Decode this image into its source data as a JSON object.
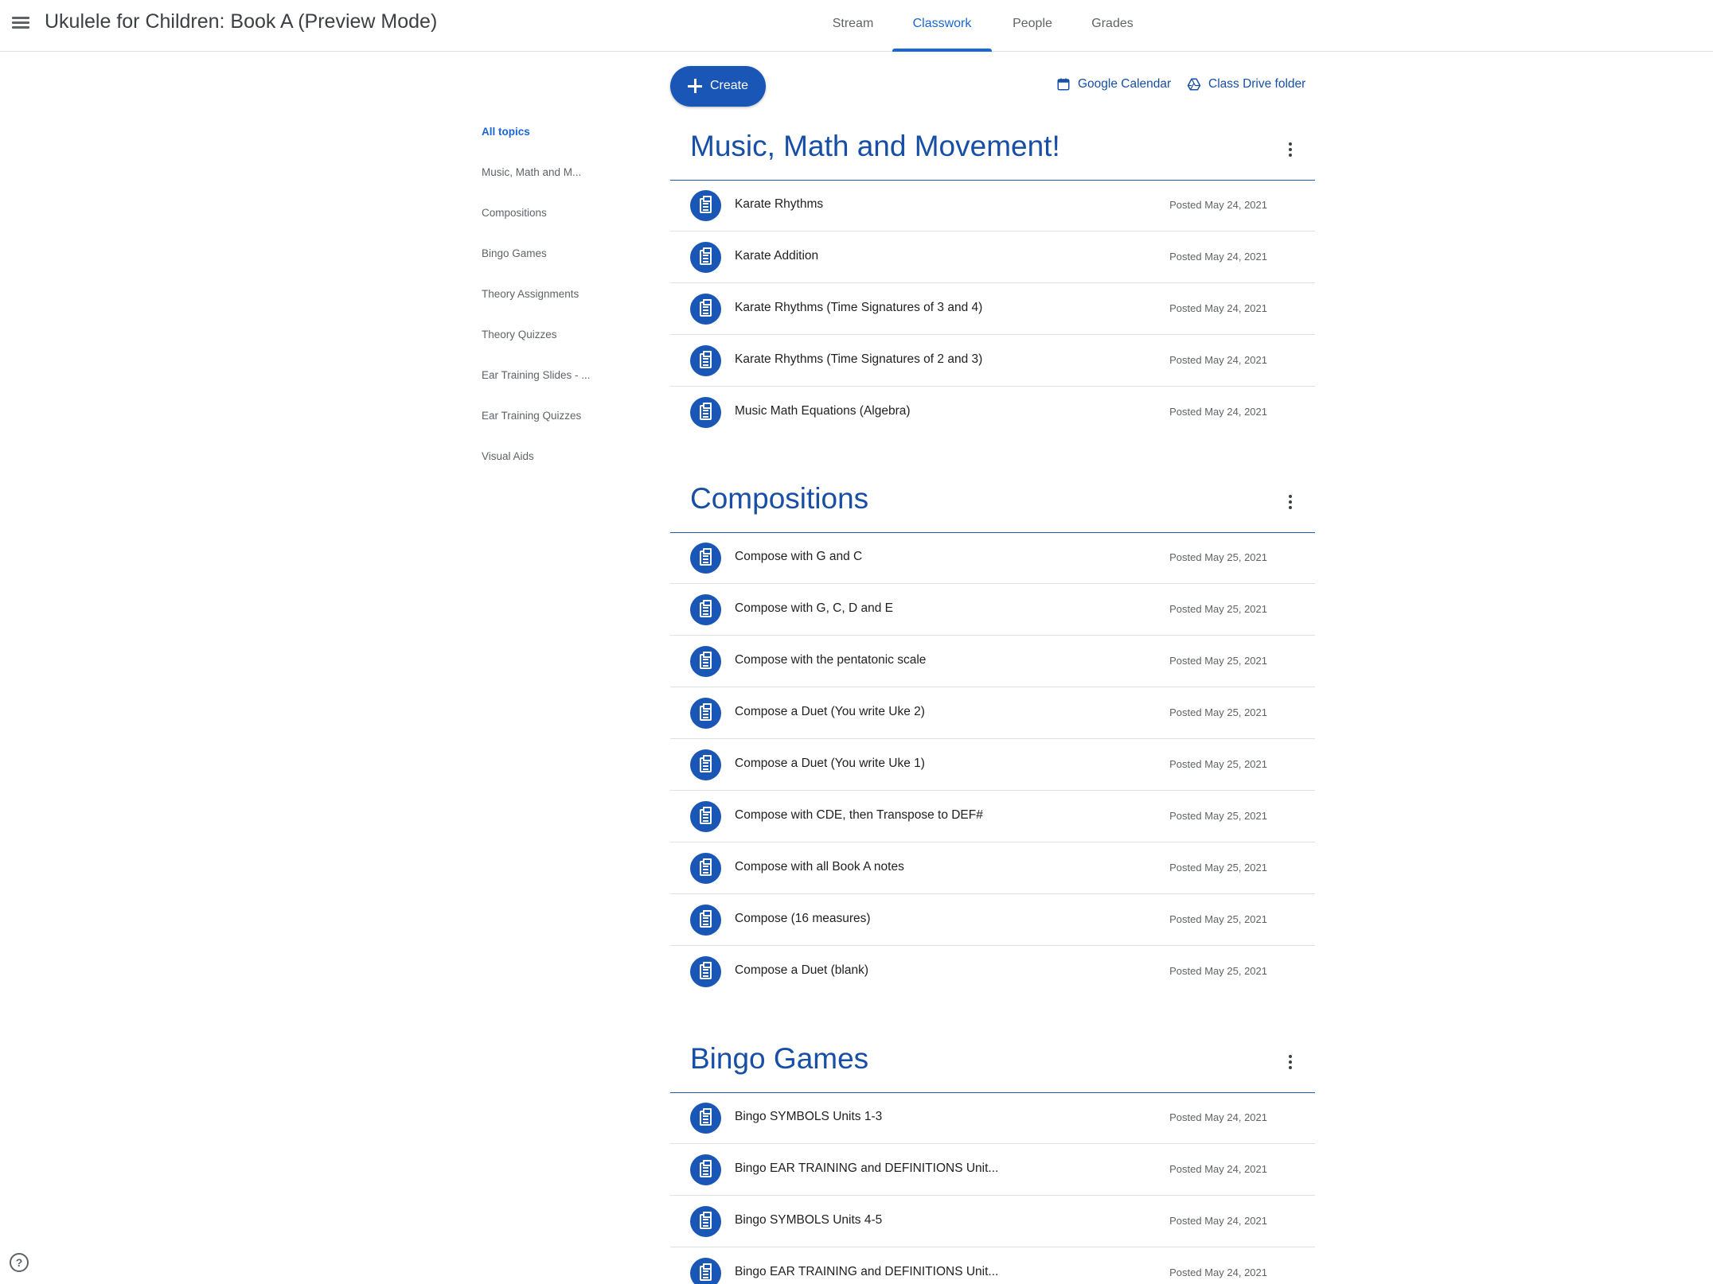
{
  "header": {
    "title": "Ukulele for Children: Book A (Preview Mode)",
    "tabs": [
      {
        "label": "Stream",
        "active": false
      },
      {
        "label": "Classwork",
        "active": true
      },
      {
        "label": "People",
        "active": false
      },
      {
        "label": "Grades",
        "active": false
      }
    ]
  },
  "actions": {
    "create_label": "Create",
    "calendar_label": "Google Calendar",
    "drive_label": "Class Drive folder"
  },
  "sidebar": {
    "items": [
      {
        "label": "All topics",
        "active": true
      },
      {
        "label": "Music, Math and M...",
        "active": false
      },
      {
        "label": "Compositions",
        "active": false
      },
      {
        "label": "Bingo Games",
        "active": false
      },
      {
        "label": "Theory Assignments",
        "active": false
      },
      {
        "label": "Theory Quizzes",
        "active": false
      },
      {
        "label": "Ear Training Slides - ...",
        "active": false
      },
      {
        "label": "Ear Training Quizzes",
        "active": false
      },
      {
        "label": "Visual Aids",
        "active": false
      }
    ]
  },
  "sections": [
    {
      "title": "Music, Math and Movement!",
      "items": [
        {
          "title": "Karate Rhythms",
          "date": "Posted May 24, 2021"
        },
        {
          "title": "Karate Addition",
          "date": "Posted May 24, 2021"
        },
        {
          "title": "Karate Rhythms (Time Signatures of 3 and 4)",
          "date": "Posted May 24, 2021"
        },
        {
          "title": "Karate Rhythms (Time Signatures of 2 and 3)",
          "date": "Posted May 24, 2021"
        },
        {
          "title": "Music Math Equations (Algebra)",
          "date": "Posted May 24, 2021"
        }
      ]
    },
    {
      "title": "Compositions",
      "items": [
        {
          "title": "Compose with G and C",
          "date": "Posted May 25, 2021"
        },
        {
          "title": "Compose with G, C, D and E",
          "date": "Posted May 25, 2021"
        },
        {
          "title": "Compose with the pentatonic scale",
          "date": "Posted May 25, 2021"
        },
        {
          "title": "Compose a Duet (You write Uke 2)",
          "date": "Posted May 25, 2021"
        },
        {
          "title": "Compose a Duet (You write Uke 1)",
          "date": "Posted May 25, 2021"
        },
        {
          "title": "Compose with CDE, then Transpose to DEF#",
          "date": "Posted May 25, 2021"
        },
        {
          "title": "Compose with all Book A notes",
          "date": "Posted May 25, 2021"
        },
        {
          "title": "Compose (16 measures)",
          "date": "Posted May 25, 2021"
        },
        {
          "title": "Compose a Duet (blank)",
          "date": "Posted May 25, 2021"
        }
      ]
    },
    {
      "title": "Bingo Games",
      "items": [
        {
          "title": "Bingo SYMBOLS Units 1-3",
          "date": "Posted May 24, 2021"
        },
        {
          "title": "Bingo EAR TRAINING and DEFINITIONS Unit...",
          "date": "Posted May 24, 2021"
        },
        {
          "title": "Bingo SYMBOLS Units 4-5",
          "date": "Posted May 24, 2021"
        },
        {
          "title": "Bingo EAR TRAINING and DEFINITIONS Unit...",
          "date": "Posted May 24, 2021"
        }
      ]
    }
  ],
  "help_label": "?",
  "colors": {
    "accent": "#1967d2",
    "brand_dark": "#1a56b6",
    "heading": "#174ea6"
  },
  "icons": {
    "menu": "hamburger-menu-icon",
    "create": "plus-icon",
    "calendar": "calendar-icon",
    "drive": "drive-icon",
    "assignment": "assignment-icon",
    "more": "more-vert-icon",
    "help": "help-icon"
  }
}
